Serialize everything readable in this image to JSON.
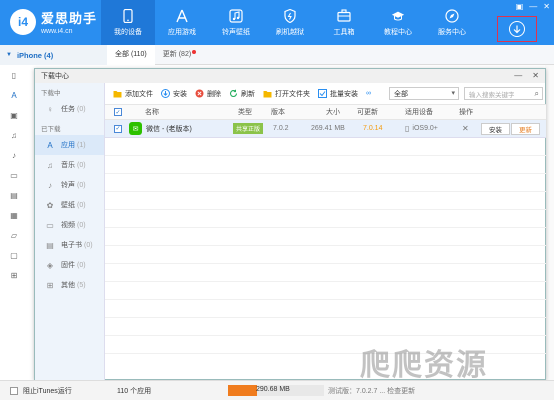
{
  "app": {
    "logo_mark": "i4",
    "name": "爱思助手",
    "url": "www.i4.cn"
  },
  "nav": [
    {
      "label": "我的设备",
      "icon": "phone-icon",
      "active": true
    },
    {
      "label": "应用游戏",
      "icon": "apps-icon",
      "active": false
    },
    {
      "label": "铃声壁纸",
      "icon": "music-icon",
      "active": false
    },
    {
      "label": "刷机越狱",
      "icon": "shield-icon",
      "active": false
    },
    {
      "label": "工具箱",
      "icon": "toolbox-icon",
      "active": false
    },
    {
      "label": "教程中心",
      "icon": "graduation-icon",
      "active": false
    },
    {
      "label": "服务中心",
      "icon": "compass-icon",
      "active": false
    }
  ],
  "window_controls": [
    "▣",
    "—",
    "✕"
  ],
  "device": {
    "name": "iPhone (4)"
  },
  "bg_tabs": [
    {
      "label": "全部 (110)",
      "active": true
    },
    {
      "label": "更新 (82)",
      "active": false
    }
  ],
  "dialog": {
    "title": "下载中心",
    "controls": [
      "—",
      "✕"
    ],
    "sidebar": {
      "group_downloading": "下载中",
      "task_label": "任务",
      "task_count": "(0)",
      "group_downloaded": "已下载",
      "items": [
        {
          "label": "应用",
          "count": "(1)",
          "icon": "app-store-icon",
          "glyph": "A",
          "active": true
        },
        {
          "label": "音乐",
          "count": "(0)",
          "icon": "music-note-icon",
          "glyph": "♫",
          "active": false
        },
        {
          "label": "铃声",
          "count": "(0)",
          "icon": "bell-icon",
          "glyph": "♪",
          "active": false
        },
        {
          "label": "壁纸",
          "count": "(0)",
          "icon": "flower-icon",
          "glyph": "✿",
          "active": false
        },
        {
          "label": "视频",
          "count": "(0)",
          "icon": "video-icon",
          "glyph": "▭",
          "active": false
        },
        {
          "label": "电子书",
          "count": "(0)",
          "icon": "book-icon",
          "glyph": "▤",
          "active": false
        },
        {
          "label": "固件",
          "count": "(0)",
          "icon": "cube-icon",
          "glyph": "◈",
          "active": false
        },
        {
          "label": "其他",
          "count": "(5)",
          "icon": "grid-icon",
          "glyph": "⊞",
          "active": false
        }
      ]
    },
    "toolbar": {
      "add_file": "添加文件",
      "install": "安装",
      "delete": "删除",
      "refresh": "刷新",
      "open_folder": "打开文件夹",
      "batch_install": "批量安装",
      "filter_value": "全部",
      "search_placeholder": "输入搜索关键字"
    },
    "table": {
      "headers": {
        "name": "名称",
        "type": "类型",
        "version": "版本",
        "size": "大小",
        "updatable": "可更新",
        "device": "适用设备",
        "action": "操作"
      },
      "rows": [
        {
          "name": "微信 - (老版本)",
          "type": "共享正版",
          "version": "7.0.2",
          "size": "269.41 MB",
          "updatable": "7.0.14",
          "device": "iOS9.0+",
          "install_label": "安装",
          "update_label": "更新"
        }
      ]
    }
  },
  "status": {
    "itunes_label": "阻止iTunes运行",
    "app_count": "110 个应用",
    "storage_used": "290.68 MB",
    "storage_fraction": 0.3,
    "right_text": "测试版：7.0.2.7 ... 检查更新"
  },
  "watermark": "爬爬资源"
}
